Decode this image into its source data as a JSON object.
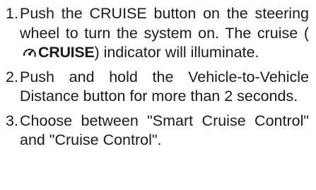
{
  "steps": [
    {
      "number": "1.",
      "text_before": "Push the CRUISE button on the steering wheel to turn the system on. The cruise (",
      "indicator_label": "CRUISE",
      "indicator_icon": "cruise-control-icon",
      "text_after": ") indicator will illuminate."
    },
    {
      "number": "2.",
      "text": "Push and hold the Vehicle-to-Vehicle Distance button for more than 2 seconds."
    },
    {
      "number": "3.",
      "text": "Choose between \"Smart Cruise Control\" and \"Cruise Control\"."
    }
  ]
}
